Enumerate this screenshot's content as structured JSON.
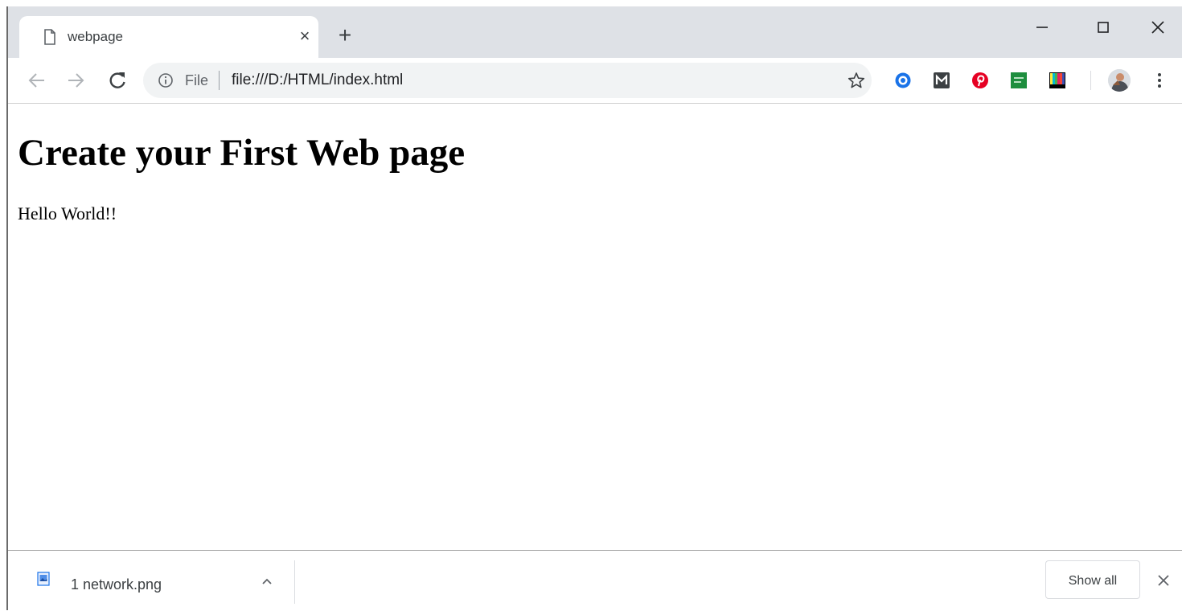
{
  "tab": {
    "title": "webpage",
    "close_glyph": "×",
    "icon": "page-icon"
  },
  "new_tab": {
    "glyph": "+"
  },
  "window_controls": {
    "icons": [
      "minimize-icon",
      "maximize-icon",
      "close-icon"
    ]
  },
  "toolbar": {
    "icons": [
      "back-arrow-icon",
      "forward-arrow-icon",
      "reload-icon"
    ]
  },
  "omnibox": {
    "scheme_label": "File",
    "url": "file:///D:/HTML/index.html",
    "info_icon": "info-circle-icon",
    "star_icon": "star-outline-icon"
  },
  "extensions": [
    {
      "name": "extension-blue-circle-icon",
      "color": "#1a73e8"
    },
    {
      "name": "extension-m-icon",
      "color": "#3c4043"
    },
    {
      "name": "pinterest-icon",
      "color": "#e60023"
    },
    {
      "name": "extension-green-square-icon",
      "color": "#1e8e3e"
    },
    {
      "name": "extension-color-bars-icon",
      "color": "#000000"
    }
  ],
  "profile": {
    "icon": "avatar"
  },
  "menu": {
    "icon": "more-vert-icon"
  },
  "page": {
    "heading": "Create your First Web page",
    "paragraph": "Hello World!!"
  },
  "downloads": {
    "filename": "1 network.png",
    "show_all_label": "Show all",
    "icons": [
      "image-file-icon",
      "chevron-up-icon",
      "close-icon"
    ]
  },
  "colors": {
    "tab_strip": "#dee1e6",
    "omnibox_bg": "#f1f3f4",
    "text": "#3c4043"
  }
}
